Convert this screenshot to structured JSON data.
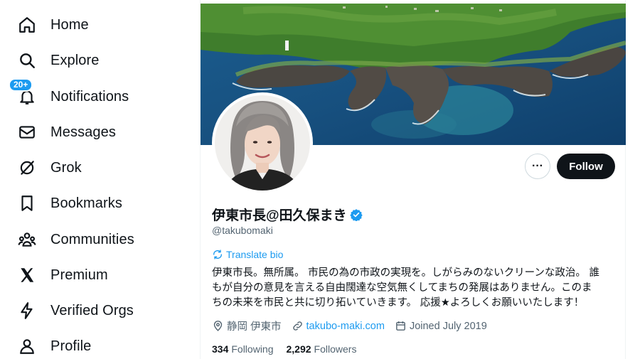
{
  "sidebar": {
    "items": [
      {
        "label": "Home",
        "icon": "home-icon"
      },
      {
        "label": "Explore",
        "icon": "search-icon"
      },
      {
        "label": "Notifications",
        "icon": "bell-icon",
        "badge": "20+"
      },
      {
        "label": "Messages",
        "icon": "envelope-icon"
      },
      {
        "label": "Grok",
        "icon": "grok-icon"
      },
      {
        "label": "Bookmarks",
        "icon": "bookmark-icon"
      },
      {
        "label": "Communities",
        "icon": "people-icon"
      },
      {
        "label": "Premium",
        "icon": "x-logo-icon"
      },
      {
        "label": "Verified Orgs",
        "icon": "lightning-icon"
      },
      {
        "label": "Profile",
        "icon": "person-icon"
      }
    ]
  },
  "profile": {
    "display_name": "伊東市長@田久保まき",
    "handle": "@takubomaki",
    "follow_label": "Follow",
    "more_label": "···",
    "translate_label": "Translate bio",
    "bio_lines": [
      "伊東市長。無所属。 市民の為の市政の実現を。しがらみのないクリーンな政治。 誰",
      "もが自分の意見を言える自由闊達な空気無くしてまちの発展はありません。このま",
      "ちの未来を市民と共に切り拓いていきます。 応援★よろしくお願いいたします！"
    ],
    "location": "静岡 伊東市",
    "website": "takubo-maki.com",
    "joined": "Joined July 2019",
    "following_count": "334",
    "following_label": "Following",
    "followers_count": "2,292",
    "followers_label": "Followers"
  },
  "colors": {
    "accent": "#1d9bf0",
    "text": "#0f1419",
    "secondary": "#536471",
    "follow_bg": "#0f1419"
  }
}
